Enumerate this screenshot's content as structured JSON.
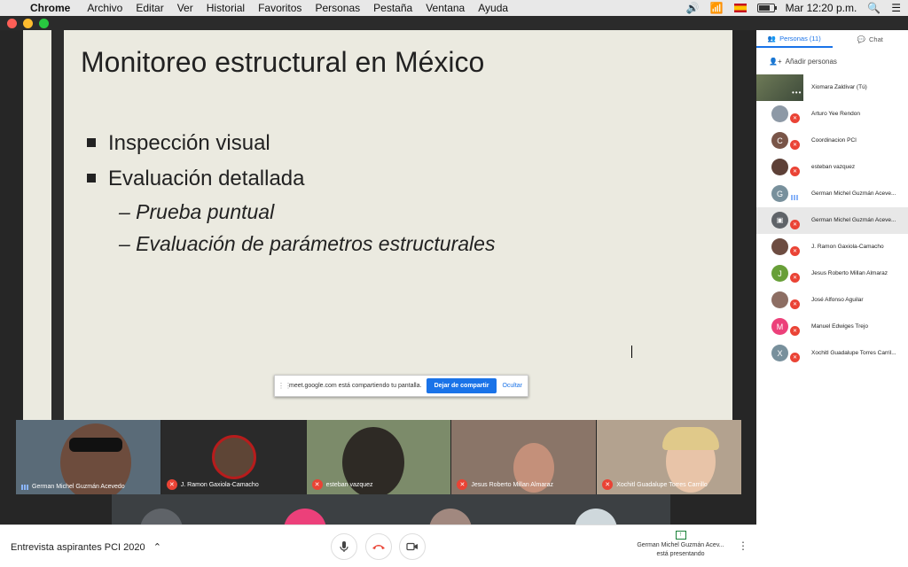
{
  "menubar": {
    "app": "Chrome",
    "items": [
      "Archivo",
      "Editar",
      "Ver",
      "Historial",
      "Favoritos",
      "Personas",
      "Pestaña",
      "Ventana",
      "Ayuda"
    ],
    "clock": "Mar 12:20 p.m."
  },
  "slide": {
    "title": "Monitoreo estructural  en México",
    "bullet1": "Inspección visual",
    "bullet2": "Evaluación detallada",
    "sub1": "– Prueba puntual",
    "sub2": "– Evaluación de parámetros estructurales"
  },
  "sharebar": {
    "message": "meet.google.com está compartiendo tu pantalla.",
    "stop_label": "Dejar de compartir",
    "hide_label": "Ocultar"
  },
  "filmstrip": [
    {
      "name": "German Michel Guzmán Acevedo",
      "muted": false,
      "bg": "#5a6b78"
    },
    {
      "name": "J. Ramon Gaxiola-Camacho",
      "muted": true,
      "bg": "#2a2a2a"
    },
    {
      "name": "esteban vazquez",
      "muted": true,
      "bg": "#7c8b6a"
    },
    {
      "name": "Jesus Roberto Millan Almaraz",
      "muted": true,
      "bg": "#8a7568"
    },
    {
      "name": "Xochitl Guadalupe Torres Carrillo",
      "muted": true,
      "bg": "#b3a28f"
    }
  ],
  "bottombar": {
    "meeting_title": "Entrevista aspirantes PCI 2020",
    "presenter": "German Michel Guzmán Acev...",
    "presenting_label": "está presentando"
  },
  "panel": {
    "tab_people": "Personas (11)",
    "tab_chat": "Chat",
    "add_people": "Añadir personas",
    "participants": [
      {
        "name": "Xiomara Zaldivar (Tú)",
        "initial": "",
        "color": "#6e7a57"
      },
      {
        "name": "Arturo Yee Rendon",
        "initial": "",
        "color": "#8d99a6"
      },
      {
        "name": "Coordinacion PCI",
        "initial": "C",
        "color": "#795548"
      },
      {
        "name": "esteban vazquez",
        "initial": "",
        "color": "#5d4037"
      },
      {
        "name": "German Michel Guzmán Aceve...",
        "initial": "G",
        "color": "#78909c"
      },
      {
        "name": "German Michel Guzmán Aceve...",
        "initial": "",
        "color": "#5f6368"
      },
      {
        "name": "J. Ramon Gaxiola-Camacho",
        "initial": "",
        "color": "#6d4c41"
      },
      {
        "name": "Jesus Roberto Millan Almaraz",
        "initial": "J",
        "color": "#689f38"
      },
      {
        "name": "José Alfonso Aguilar",
        "initial": "",
        "color": "#8d6e63"
      },
      {
        "name": "Manuel Edwiges Trejo",
        "initial": "M",
        "color": "#ec407a"
      },
      {
        "name": "Xochitl Guadalupe Torres Carril...",
        "initial": "X",
        "color": "#78909c"
      }
    ]
  },
  "colors": {
    "accent": "#1a73e8",
    "muted_red": "#ea4335"
  }
}
